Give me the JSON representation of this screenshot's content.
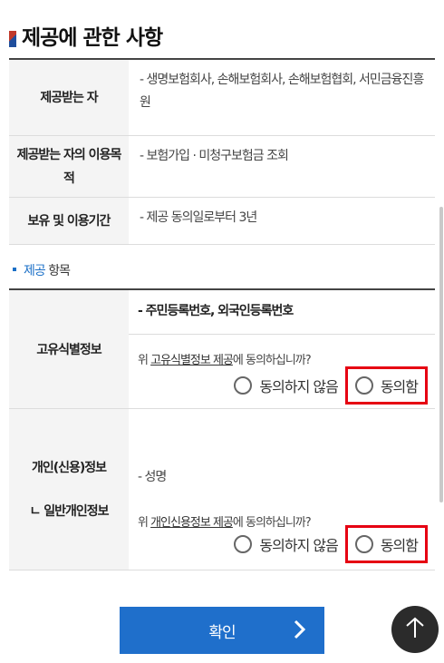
{
  "page_title": "제공에 관한 사항",
  "info_rows": [
    {
      "label": "제공받는 자",
      "value": "- 생명보험회사, 손해보험회사, 손해보험협회, 서민금융진흥원"
    },
    {
      "label": "제공받는 자의 이용목적",
      "value": "- 보험가입 · 미청구보험금 조회"
    },
    {
      "label": "보유 및 이용기간",
      "value": "- 제공 동의일로부터 3년"
    }
  ],
  "section": {
    "highlight": "제공",
    "rest": " 항목"
  },
  "items": [
    {
      "label": "고유식별정보",
      "value": "- 주민등록번호, 외국인등록번호",
      "question_prefix": "위 ",
      "question_term": "고유식별정보 제공",
      "question_suffix": "에 동의하십니까?",
      "option_no": "동의하지 않음",
      "option_yes": "동의함"
    },
    {
      "label": "개인(신용)정보",
      "sub_label": "ㄴ 일반개인정보",
      "value": "- 성명",
      "question_prefix": "위 ",
      "question_term": "개인신용정보 제공",
      "question_suffix": "에 동의하십니까?",
      "option_no": "동의하지 않음",
      "option_yes": "동의함"
    }
  ],
  "confirm_button": "확인",
  "colors": {
    "accent": "#1f6fcb",
    "highlight_box": "#e60012",
    "top_button": "#2b2b2b"
  },
  "icons": {
    "confirm": "chevron-right-icon",
    "top": "arrow-up-icon"
  }
}
